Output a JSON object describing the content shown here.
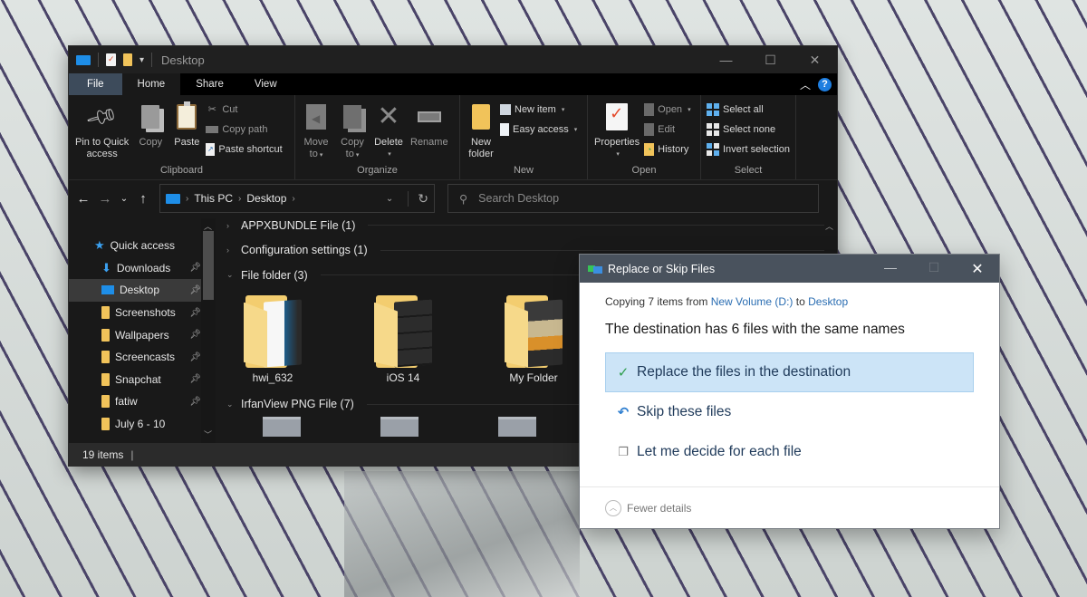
{
  "explorer": {
    "title": "Desktop",
    "window_controls": {
      "minimize": "—",
      "maximize": "☐",
      "close": "✕"
    },
    "tabs": [
      {
        "label": "File",
        "active": false
      },
      {
        "label": "Home",
        "active": true
      },
      {
        "label": "Share",
        "active": false
      },
      {
        "label": "View",
        "active": false
      }
    ],
    "help_label": "?",
    "ribbon": {
      "clipboard": {
        "label": "Clipboard",
        "pin": "Pin to Quick access",
        "pin_line1": "Pin to Quick",
        "pin_line2": "access",
        "copy": "Copy",
        "paste": "Paste",
        "cut": "Cut",
        "copy_path": "Copy path",
        "paste_shortcut": "Paste shortcut"
      },
      "organize": {
        "label": "Organize",
        "move_line1": "Move",
        "move_line2": "to",
        "copy_line1": "Copy",
        "copy_line2": "to",
        "delete": "Delete",
        "rename": "Rename"
      },
      "new": {
        "label": "New",
        "new_folder_line1": "New",
        "new_folder_line2": "folder",
        "new_item": "New item",
        "easy_access": "Easy access"
      },
      "open": {
        "label": "Open",
        "properties": "Properties",
        "open": "Open",
        "edit": "Edit",
        "history": "History"
      },
      "select": {
        "label": "Select",
        "select_all": "Select all",
        "select_none": "Select none",
        "invert_selection": "Invert selection"
      }
    },
    "address": {
      "crumbs": [
        "This PC",
        "Desktop"
      ],
      "search_placeholder": "Search Desktop"
    },
    "nav_pane": {
      "items": [
        {
          "label": "Quick access",
          "icon": "star-icon",
          "pinned": false,
          "selected": false
        },
        {
          "label": "Downloads",
          "icon": "download-icon",
          "pinned": true,
          "selected": false
        },
        {
          "label": "Desktop",
          "icon": "desktop-icon",
          "pinned": true,
          "selected": true
        },
        {
          "label": "Screenshots",
          "icon": "folder-icon",
          "pinned": true,
          "selected": false
        },
        {
          "label": "Wallpapers",
          "icon": "folder-icon",
          "pinned": true,
          "selected": false
        },
        {
          "label": "Screencasts",
          "icon": "folder-icon",
          "pinned": true,
          "selected": false
        },
        {
          "label": "Snapchat",
          "icon": "folder-icon",
          "pinned": true,
          "selected": false
        },
        {
          "label": "fatiw",
          "icon": "folder-icon",
          "pinned": true,
          "selected": false
        },
        {
          "label": "July 6 - 10",
          "icon": "folder-icon",
          "pinned": false,
          "selected": false
        }
      ]
    },
    "groups": [
      {
        "label": "APPXBUNDLE File (1)",
        "expanded": false
      },
      {
        "label": "Configuration settings (1)",
        "expanded": false
      },
      {
        "label": "File folder (3)",
        "expanded": true
      },
      {
        "label": "IrfanView PNG File (7)",
        "expanded": true
      }
    ],
    "folders": [
      {
        "name": "hwi_632"
      },
      {
        "name": "iOS 14"
      },
      {
        "name": "My Folder"
      }
    ],
    "status": {
      "item_count": "19 items"
    }
  },
  "dialog": {
    "title": "Replace or Skip Files",
    "copying_prefix": "Copying 7 items from ",
    "source": "New Volume (D:)",
    "to_word": " to ",
    "destination": "Desktop",
    "headline": "The destination has 6 files with the same names",
    "options": [
      {
        "label": "Replace the files in the destination",
        "icon": "check-icon",
        "selected": true
      },
      {
        "label": "Skip these files",
        "icon": "skip-icon",
        "selected": false
      },
      {
        "label": "Let me decide for each file",
        "icon": "decide-icon",
        "selected": false
      }
    ],
    "fewer_details": "Fewer details",
    "colors": {
      "link": "#2a6db2",
      "selected_bg": "#cce4f7",
      "titlebar": "#49525d"
    }
  }
}
